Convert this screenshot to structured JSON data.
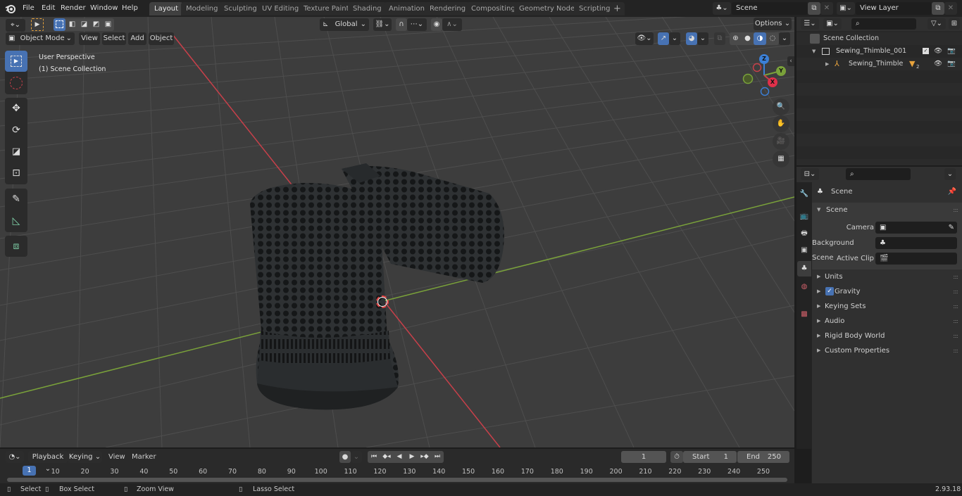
{
  "menubar": {
    "app_icon": "blender-logo-icon",
    "items": [
      "File",
      "Edit",
      "Render",
      "Window",
      "Help"
    ],
    "workspaces": [
      "Layout",
      "Modeling",
      "Sculpting",
      "UV Editing",
      "Texture Paint",
      "Shading",
      "Animation",
      "Rendering",
      "Compositing",
      "Geometry Nodes",
      "Scripting"
    ],
    "active_workspace": "Layout",
    "add_workspace": "+",
    "scene_field": "Scene",
    "view_layer_field": "View Layer"
  },
  "viewport": {
    "mode": "Object Mode",
    "menus": [
      "View",
      "Select",
      "Add",
      "Object"
    ],
    "transform_orientation": "Global",
    "options_label": "Options",
    "overlay_text_line1": "User Perspective",
    "overlay_text_line2": "(1) Scene Collection",
    "gizmo": {
      "x": "X",
      "y": "Y",
      "z": "Z"
    },
    "shading_active": "material-preview",
    "tools": [
      "select-box",
      "cursor",
      "move",
      "rotate",
      "scale",
      "transform",
      "annotate",
      "measure",
      "add-cube"
    ],
    "object_name": "Sewing_Thimble"
  },
  "outliner": {
    "search_placeholder": "",
    "root": "Scene Collection",
    "items": [
      {
        "label": "Sewing_Thimble_001",
        "type": "collection",
        "expanded": true
      },
      {
        "label": "Sewing_Thimble",
        "type": "object",
        "expanded": false,
        "modifier_badge": "2"
      }
    ]
  },
  "properties": {
    "context_label": "Scene",
    "section_label": "Scene",
    "fields": [
      {
        "label": "Camera",
        "value": ""
      },
      {
        "label": "Background Scene",
        "value": ""
      },
      {
        "label": "Active Clip",
        "value": ""
      }
    ],
    "panels": [
      {
        "label": "Units",
        "checkbox": false
      },
      {
        "label": "Gravity",
        "checkbox": true,
        "checked": true
      },
      {
        "label": "Keying Sets",
        "checkbox": false
      },
      {
        "label": "Audio",
        "checkbox": false
      },
      {
        "label": "Rigid Body World",
        "checkbox": false
      },
      {
        "label": "Custom Properties",
        "checkbox": false
      }
    ],
    "tabs": [
      "tool",
      "render",
      "output",
      "view-layer",
      "scene",
      "world",
      "texture"
    ],
    "active_tab": "scene"
  },
  "timeline": {
    "menus": [
      "Playback",
      "Keying",
      "View",
      "Marker"
    ],
    "current_frame": "1",
    "start_label": "Start",
    "start_value": "1",
    "end_label": "End",
    "end_value": "250",
    "ticks": [
      "10",
      "20",
      "30",
      "40",
      "50",
      "60",
      "70",
      "80",
      "90",
      "100",
      "110",
      "120",
      "130",
      "140",
      "150",
      "160",
      "170",
      "180",
      "190",
      "200",
      "210",
      "220",
      "230",
      "240",
      "250"
    ],
    "playhead": "1"
  },
  "statusbar": {
    "items": [
      "Select",
      "Box Select",
      "Zoom View",
      "Lasso Select"
    ],
    "version": "2.93.18"
  },
  "colors": {
    "accent_blue": "#4772b3",
    "axis_x": "#c8404a",
    "axis_y": "#7aa23a",
    "axis_z": "#3b7fd6",
    "active_tool_orange": "#e8a33c"
  }
}
